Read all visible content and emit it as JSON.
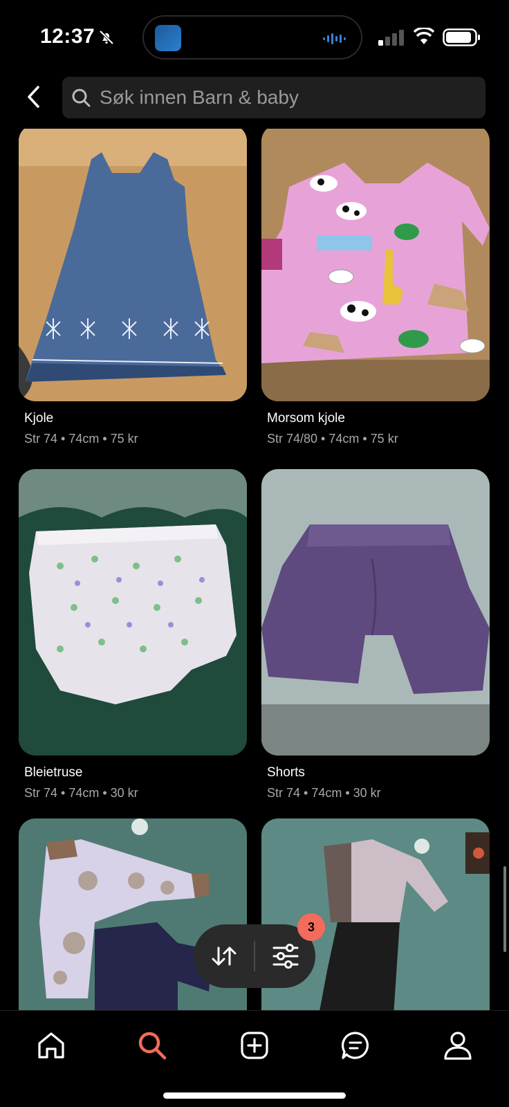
{
  "status_bar": {
    "time": "12:37"
  },
  "search": {
    "placeholder": "Søk innen Barn & baby"
  },
  "listings": [
    {
      "title": "Kjole",
      "meta": "Str 74 • 74cm • 75 kr"
    },
    {
      "title": "Morsom kjole",
      "meta": "Str 74/80 • 74cm • 75 kr"
    },
    {
      "title": "Bleietruse",
      "meta": "Str 74 • 74cm • 30 kr"
    },
    {
      "title": "Shorts",
      "meta": "Str 74 • 74cm • 30 kr"
    },
    {
      "title": "",
      "meta": ""
    },
    {
      "title": "",
      "meta": ""
    }
  ],
  "filter": {
    "active_count": "3"
  },
  "tab_bar": {
    "items": [
      {
        "icon": "home-icon"
      },
      {
        "icon": "search-icon",
        "active": true
      },
      {
        "icon": "add-icon"
      },
      {
        "icon": "messages-icon"
      },
      {
        "icon": "profile-icon"
      }
    ]
  },
  "colors": {
    "accent": "#f26b5b",
    "background": "#000000",
    "search_bg": "#1f1f1f"
  }
}
